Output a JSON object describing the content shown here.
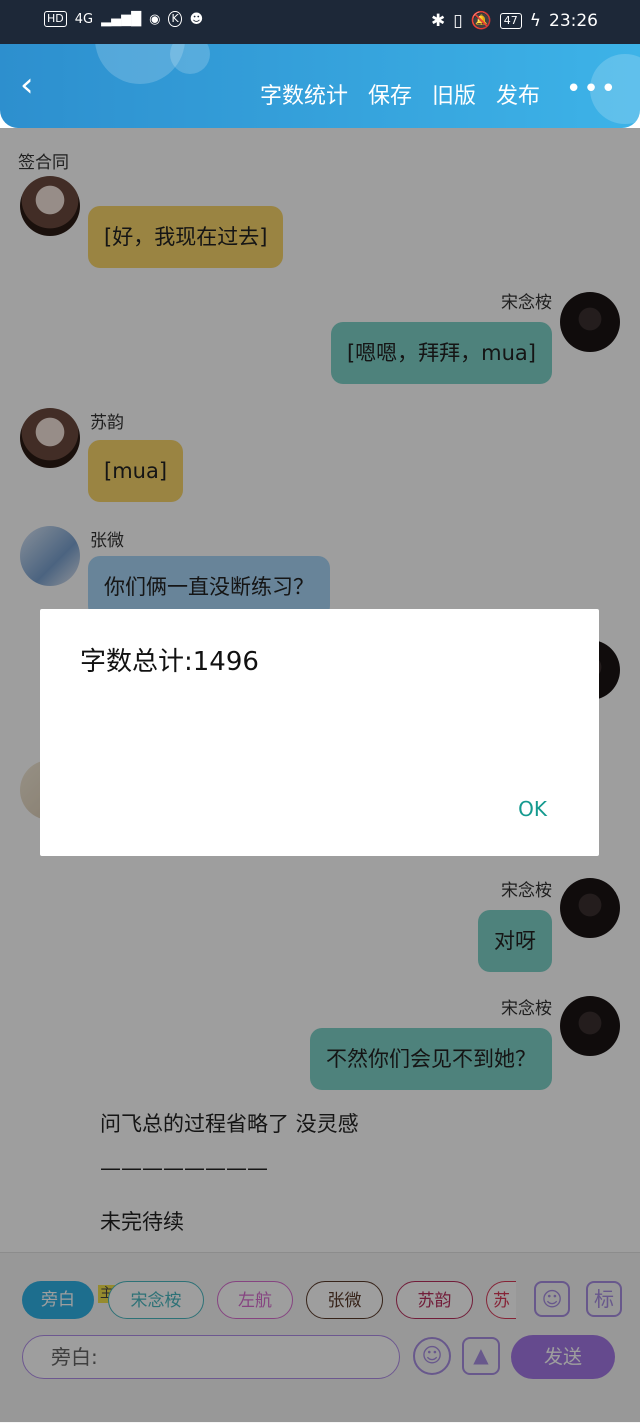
{
  "status_bar": {
    "left": [
      "HD",
      "4G",
      "K"
    ],
    "battery": "47",
    "time": "23:26"
  },
  "app_bar": {
    "actions": [
      "字数统计",
      "保存",
      "旧版",
      "发布"
    ],
    "more": "•••"
  },
  "subtitle": "签合同",
  "messages": [
    {
      "text": "[好，我现在过去]"
    },
    {
      "sender": "宋念桉",
      "text": "[嗯嗯，拜拜，mua]"
    },
    {
      "sender": "苏韵",
      "text": "[mua]"
    },
    {
      "sender": "张微",
      "text": "你们俩一直没断练习？"
    },
    {
      "sender": "宋念桉",
      "text": "对呀"
    },
    {
      "sender": "宋念桉",
      "text": "不然你们会见不到她？"
    }
  ],
  "narration": [
    "问飞总的过程省略了 没灵感",
    "————————",
    "未完待续"
  ],
  "dialog": {
    "title": "字数总计:1496",
    "ok": "OK"
  },
  "roles": {
    "aside": "旁白",
    "main_tag": "主",
    "list": [
      "宋念桉",
      "左航",
      "张微",
      "苏韵",
      "苏"
    ]
  },
  "icons": {
    "person": "person-icon",
    "mark": "标"
  },
  "input": {
    "placeholder": "旁白:"
  },
  "send": "发送"
}
